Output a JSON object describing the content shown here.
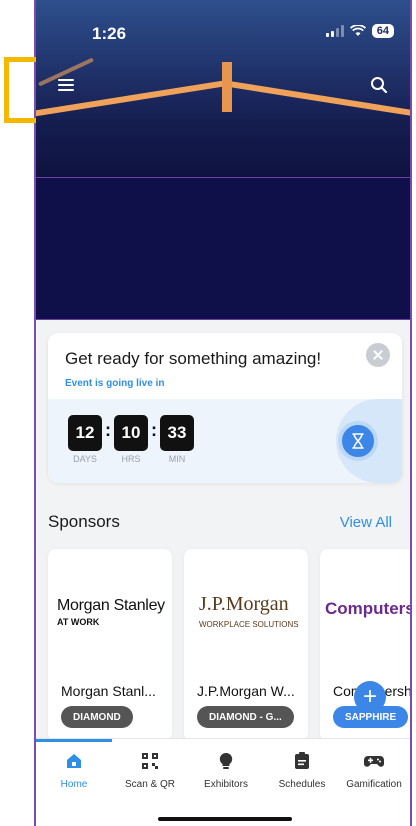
{
  "status_bar": {
    "time": "1:26",
    "battery": "64"
  },
  "live_card": {
    "title": "Get ready for something amazing!",
    "subtitle": "Event is going live in",
    "timer": [
      {
        "value": "12",
        "label": "DAYS"
      },
      {
        "value": "10",
        "label": "HRS"
      },
      {
        "value": "33",
        "label": "MIN"
      }
    ]
  },
  "sponsors": {
    "heading": "Sponsors",
    "view_all": "View All",
    "items": [
      {
        "logo_line1": "Morgan Stanley",
        "logo_line2": "AT WORK",
        "name": "Morgan Stanl...",
        "tier": "DIAMOND",
        "tier_color": "#555555"
      },
      {
        "logo_line1": "J.P.Morgan",
        "logo_line2": "WORKPLACE SOLUTIONS",
        "name": "J.P.Morgan W...",
        "tier": "DIAMOND - G...",
        "tier_color": "#555555"
      },
      {
        "logo_line1": "Computersh",
        "name_prefix": "Com",
        "name_suffix": "ersh",
        "tier": "SAPPHIRE",
        "tier_color": "#3b86e6"
      }
    ]
  },
  "tabs": [
    {
      "label": "Home",
      "icon": "home-icon"
    },
    {
      "label": "Scan & QR",
      "icon": "qr-icon"
    },
    {
      "label": "Exhibitors",
      "icon": "bulb-icon"
    },
    {
      "label": "Schedules",
      "icon": "clipboard-icon"
    },
    {
      "label": "Gamification",
      "icon": "gamepad-icon"
    }
  ],
  "colors": {
    "accent": "#2f8fe6",
    "highlight": "#f5b800",
    "frame": "#7b4bb0"
  }
}
